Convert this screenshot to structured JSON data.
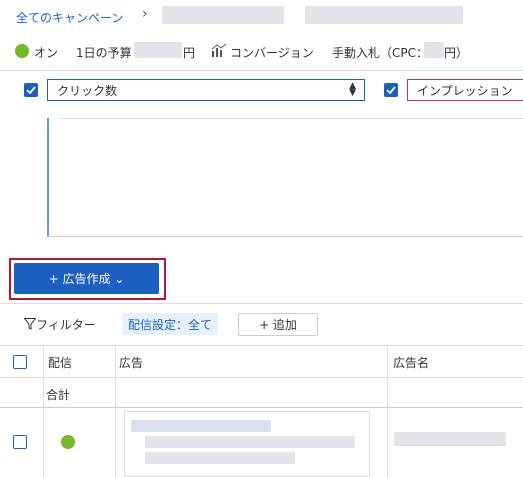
{
  "breadcrumb": {
    "all_campaigns": "全てのキャンペーン",
    "separator": "›"
  },
  "status": {
    "on_label": "オン",
    "daily_budget_label": "1日の予算",
    "yen": "円",
    "bid_strategy": "コンバージョン",
    "manual_bid": "手動入札（CPC：",
    "manual_bid_end": "円）"
  },
  "metrics": {
    "metric1": "クリック数",
    "metric2": "インプレッション"
  },
  "create": {
    "label": "+ 広告作成 ⌄"
  },
  "filter": {
    "filter_label": "フィルター",
    "chip": "配信設定：全て",
    "add_label": "+ 追加"
  },
  "table": {
    "col_delivery": "配信",
    "col_ad": "広告",
    "col_ad_name": "広告名",
    "total_label": "合計"
  },
  "colors": {
    "accent": "#1b5fc1",
    "highlight": "#b0163d",
    "status_on": "#76b82a"
  }
}
